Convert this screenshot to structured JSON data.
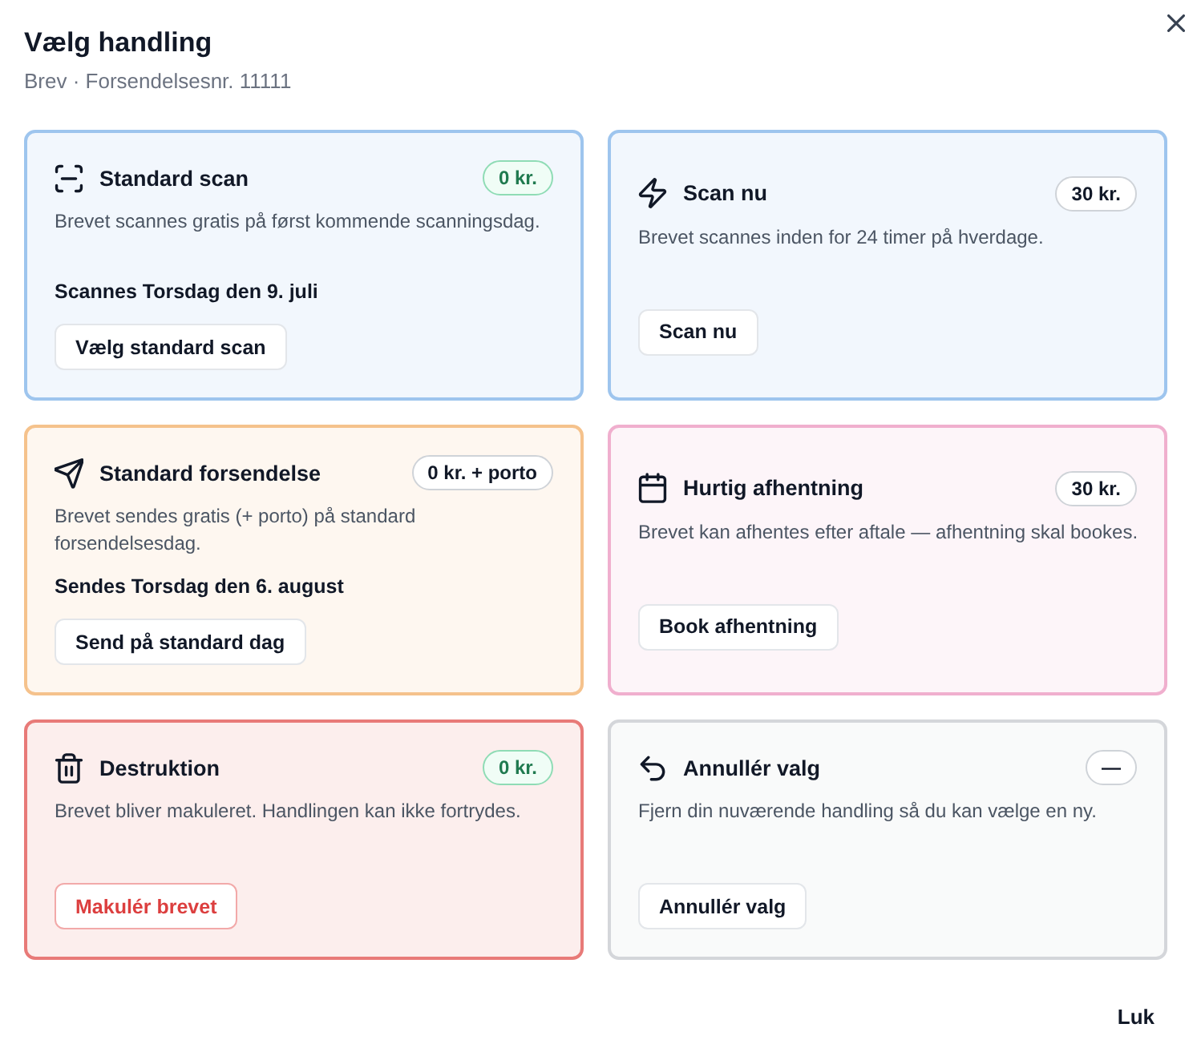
{
  "dialog": {
    "title": "Vælg handling",
    "subtitle": "Brev · Forsendelsesnr. 11111"
  },
  "options": [
    {
      "title": "Standard scan",
      "color": "#9ec5ee",
      "price": {
        "text": "0 kr.",
        "kind": "free"
      },
      "description": "Brevet scannes gratis på først kommende scanningsdag.",
      "note": "Scannes Torsdag den 9. juli",
      "button": {
        "label": "Vælg standard scan",
        "kind": "default"
      }
    },
    {
      "title": "Scan nu",
      "color": "#9ec5ee",
      "price": {
        "text": "30 kr.",
        "kind": "neutral"
      },
      "description": "Brevet scannes inden for 24 timer på hverdage.",
      "button": {
        "label": "Scan nu",
        "kind": "default"
      }
    },
    {
      "title": "Standard forsendelse",
      "color": "#f5c28c",
      "price": {
        "text": "0 kr. + porto",
        "kind": "neutral"
      },
      "description": "Brevet sendes gratis (+ porto) på standard forsendelsesdag.",
      "note": "Sendes Torsdag den 6. august",
      "button": {
        "label": "Send på standard dag",
        "kind": "default"
      }
    },
    {
      "title": "Hurtig afhentning",
      "color": "#f0afce",
      "price": {
        "text": "30 kr.",
        "kind": "neutral"
      },
      "description": "Brevet kan afhentes efter aftale — afhentning skal bookes.",
      "button": {
        "label": "Book afhentning",
        "kind": "default"
      }
    },
    {
      "title": "Destruktion",
      "color": "#e87a78",
      "price": {
        "text": "0 kr.",
        "kind": "free"
      },
      "description": "Brevet bliver makuleret. Handlingen kan ikke fortrydes.",
      "button": {
        "label": "Makulér brevet",
        "kind": "danger"
      }
    },
    {
      "title": "Annullér valg",
      "color": "#d4d6da",
      "price": {
        "text": "—",
        "kind": "neutral"
      },
      "description": "Fjern din nuværende handling så du kan vælge en ny.",
      "button": {
        "label": "Annullér valg",
        "kind": "default"
      }
    }
  ],
  "footer": {
    "button": "Luk"
  }
}
